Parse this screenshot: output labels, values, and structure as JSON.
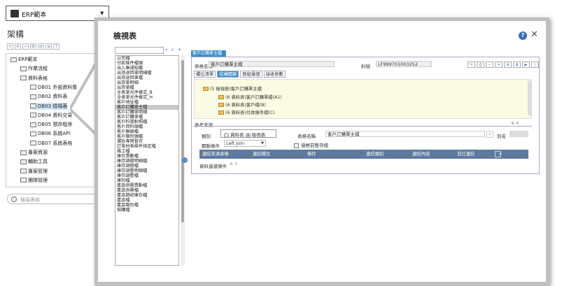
{
  "left": {
    "select": "ERP範本",
    "arch_title": "架構",
    "toolbar": [
      "+",
      "✕",
      "✓",
      "⚙",
      "⇄",
      "≡",
      "?"
    ],
    "tree": [
      {
        "label": "ERP範本",
        "indent": 0,
        "icon": "module"
      },
      {
        "label": "作業流程",
        "indent": 1
      },
      {
        "label": "資料表格",
        "indent": 1
      },
      {
        "label": "DB01 外部資料集",
        "indent": 2
      },
      {
        "label": "DB02 資料表",
        "indent": 2
      },
      {
        "label": "DB03 檢視表",
        "indent": 2,
        "selected": true
      },
      {
        "label": "DB04 資料交易",
        "indent": 2
      },
      {
        "label": "DB05 預存程序",
        "indent": 2
      },
      {
        "label": "DB06 系統API",
        "indent": 2
      },
      {
        "label": "DB07 系統表格",
        "indent": 2
      },
      {
        "label": "專案資源",
        "indent": 1
      },
      {
        "label": "輔助工具",
        "indent": 1
      },
      {
        "label": "專案管理",
        "indent": 1
      },
      {
        "label": "團隊管理",
        "indent": 1
      }
    ],
    "search_placeholder": "搜尋表格"
  },
  "window": {
    "title": "檢視表",
    "list_items": [
      "公司檔",
      "付款條件檔頭",
      "出入庫通知檔",
      "出貨退回單明細檔",
      "出貨退回單檔",
      "出貨單明細",
      "出貨單檔",
      "全表單光件樣式_B",
      "全表單光件樣式_H",
      "客戶地址檔",
      "客戶訂購單主檔",
      "客戶訂購單明細",
      "客戶訂購單檔",
      "客戶料號對照檔",
      "客戶資料頭檔",
      "客戶聯絡檔",
      "客戶類別頭檔",
      "選拆專用暫存",
      "訂單材表條件指定檔",
      "員工檔",
      "庫存異動檔",
      "庫存調撥明細檔",
      "庫存調撥檔",
      "庫存調整明細檔",
      "庫存調整檔",
      "庫別檔",
      "產品供需異動檔",
      "產品供需檔",
      "產品期初庫存檔",
      "產品檔",
      "產品類別檔",
      "採購檔"
    ],
    "selected_index": 10,
    "detail": {
      "tab": "客戶訂購單主檔",
      "table_name_label": "表格名稱",
      "table_name": "客戶訂購單主檔",
      "number_label": "料號",
      "number": "LF999701003252",
      "tool_icons": [
        "✎",
        "⎙",
        "—",
        "✕",
        "⊞",
        "⧉",
        "▶",
        "▯"
      ],
      "subtabs": [
        "欄位清單",
        "結構關聯",
        "群組彙總",
        "接收參數"
      ],
      "active_subtab": 1,
      "tree_root": "(5 檢視表)客戶訂購單主檔",
      "tree_children": [
        "(6 資料表)客戶訂購單檔(A1)",
        "(6 資料表)客戶檔(B)",
        "(6 資料表)付款條件檔(C)"
      ],
      "ref_title": "參考來源",
      "ref_buttons": "⊕ ✕",
      "category_label": "類別",
      "radio_options": [
        "資料表",
        "檢視表"
      ],
      "radio_selected": 1,
      "table_name2_label": "表格名稱",
      "table_name2": "客戶訂購單主檔",
      "table_name2_btn": "⌕",
      "alias_label": "別名",
      "link_label": "關聯條件",
      "link_value": "Left Join",
      "checkbox_label": "過帳前暫存檔",
      "grid_headers": [
        "連結來源表格",
        "連結欄位",
        "條件",
        "連結類別",
        "連結內容",
        "自訂連結"
      ],
      "grid_add": "+",
      "filter_label": "資料過濾條件",
      "filter_buttons": "⊕ ✕"
    },
    "help": "?",
    "close": "✕"
  }
}
